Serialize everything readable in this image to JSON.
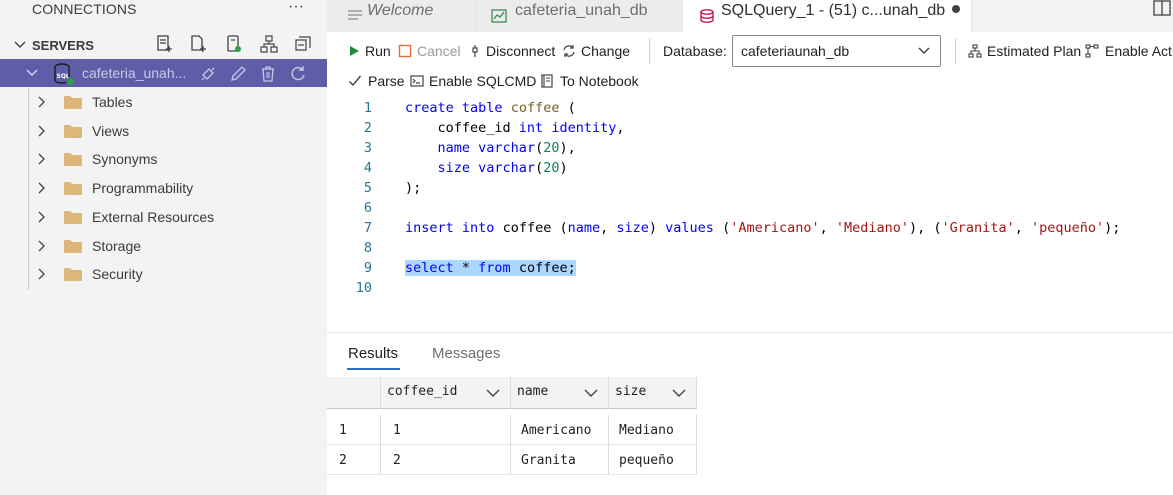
{
  "sidebar": {
    "title": "CONNECTIONS",
    "more_glyph": "···",
    "servers_label": "SERVERS",
    "server_actions": [
      "new-connection-icon",
      "new-query-icon",
      "new-server-group-icon",
      "show-hierarchy-icon",
      "collapse-all-icon"
    ],
    "connection": {
      "label": "cafeteria_unah...",
      "icon": "sql-database-icon",
      "status_color": "#2ea043",
      "actions": [
        "disconnect-icon",
        "edit-icon",
        "delete-icon",
        "refresh-icon"
      ]
    },
    "tree": [
      "Tables",
      "Views",
      "Synonyms",
      "Programmability",
      "External Resources",
      "Storage",
      "Security"
    ]
  },
  "tabs": [
    {
      "label": "Welcome",
      "icon": "welcome-icon"
    },
    {
      "label": "cafeteria_unah_db",
      "icon": "dashboard-icon"
    },
    {
      "label": "SQLQuery_1 - (51) c...unah_db",
      "icon": "database-icon",
      "unsaved": true
    }
  ],
  "toolbar": {
    "run": "Run",
    "cancel": "Cancel",
    "disconnect": "Disconnect",
    "change": "Change",
    "database_label": "Database:",
    "database_value": "cafeteriaunah_db",
    "estimated_plan": "Estimated Plan",
    "enable_actual": "Enable Actu",
    "parse": "Parse",
    "enable_sqlcmd": "Enable SQLCMD",
    "to_notebook": "To Notebook"
  },
  "editor": {
    "line_numbers": [
      "1",
      "2",
      "3",
      "4",
      "5",
      "6",
      "7",
      "8",
      "9",
      "10"
    ],
    "lines": [
      "create table coffee (",
      "    coffee_id int identity,",
      "    name varchar(20),",
      "    size varchar(20)",
      ");",
      "",
      "insert into coffee (name, size) values ('Americano', 'Mediano'), ('Granita', 'pequeño');",
      "",
      "select * from coffee;",
      ""
    ]
  },
  "results": {
    "tabs": [
      "Results",
      "Messages"
    ],
    "columns": [
      "coffee_id",
      "name",
      "size"
    ],
    "rows": [
      {
        "n": "1",
        "cells": [
          "1",
          "Americano",
          "Mediano"
        ]
      },
      {
        "n": "2",
        "cells": [
          "2",
          "Granita",
          "pequeño"
        ]
      }
    ]
  },
  "colors": {
    "selection_row": "#5e5ea8",
    "keyword": "#0000ff",
    "string": "#a31515",
    "number": "#098658",
    "line_number": "#237893",
    "code_selection": "#add6ff"
  }
}
